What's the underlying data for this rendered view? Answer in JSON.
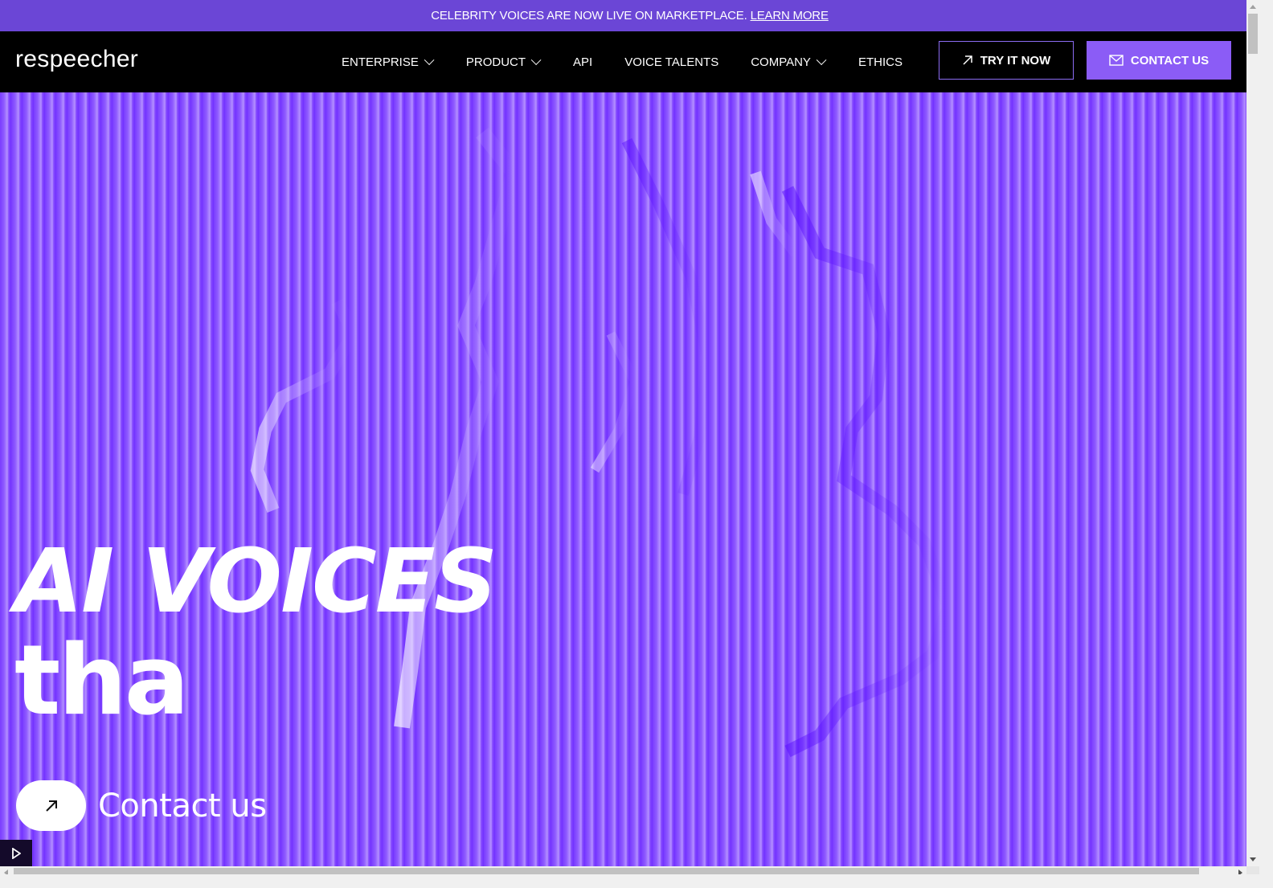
{
  "banner": {
    "text": "CELEBRITY VOICES ARE NOW LIVE ON MARKETPLACE.",
    "link_label": "LEARN MORE"
  },
  "nav": {
    "logo": "respeecher",
    "items": [
      {
        "label": "ENTERPRISE",
        "has_dropdown": true
      },
      {
        "label": "PRODUCT",
        "has_dropdown": true
      },
      {
        "label": "API",
        "has_dropdown": false
      },
      {
        "label": "VOICE TALENTS",
        "has_dropdown": false
      },
      {
        "label": "COMPANY",
        "has_dropdown": true
      },
      {
        "label": "ETHICS",
        "has_dropdown": false
      }
    ],
    "try_label": "TRY IT NOW",
    "try_icon": "arrow-up-right-icon",
    "contact_label": "CONTACT US",
    "contact_icon": "mail-icon"
  },
  "hero": {
    "headline_line1": "AI VOICES",
    "headline_line2": "tha",
    "cta_label": "Contact us",
    "cta_icon": "arrow-up-right-icon",
    "play_icon": "play-icon"
  },
  "colors": {
    "banner_bg": "#6b46d6",
    "nav_bg": "#000000",
    "accent": "#8b5cf6",
    "hero_bg": "#7a3cff"
  }
}
